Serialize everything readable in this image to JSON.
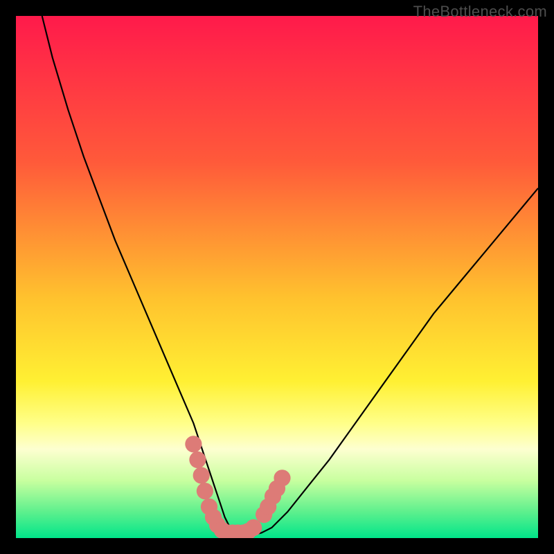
{
  "watermark": "TheBottleneck.com",
  "chart_data": {
    "type": "line",
    "title": "",
    "xlabel": "",
    "ylabel": "",
    "xlim": [
      0,
      100
    ],
    "ylim": [
      0,
      100
    ],
    "background_gradient": {
      "stops": [
        {
          "offset": 0,
          "color": "#ff1a4b"
        },
        {
          "offset": 28,
          "color": "#ff5a3a"
        },
        {
          "offset": 54,
          "color": "#ffc22e"
        },
        {
          "offset": 70,
          "color": "#fff033"
        },
        {
          "offset": 78,
          "color": "#ffff88"
        },
        {
          "offset": 83,
          "color": "#fdffd0"
        },
        {
          "offset": 89,
          "color": "#c8ff9f"
        },
        {
          "offset": 95,
          "color": "#5df08d"
        },
        {
          "offset": 100,
          "color": "#00e58a"
        }
      ]
    },
    "series": [
      {
        "name": "curve",
        "color": "#000000",
        "x": [
          5,
          7,
          10,
          13,
          16,
          19,
          22,
          25,
          28,
          31,
          34,
          35,
          36,
          37,
          38,
          39,
          40,
          41,
          42,
          43,
          45,
          47,
          49,
          52,
          56,
          60,
          65,
          70,
          75,
          80,
          85,
          90,
          95,
          100
        ],
        "values": [
          100,
          92,
          82,
          73,
          65,
          57,
          50,
          43,
          36,
          29,
          22,
          19,
          16,
          13,
          10,
          7,
          4,
          2,
          1,
          0.5,
          0.5,
          1,
          2,
          5,
          10,
          15,
          22,
          29,
          36,
          43,
          49,
          55,
          61,
          67
        ]
      }
    ],
    "markers": {
      "name": "dots",
      "color": "#dd7b77",
      "radius": 1.6,
      "points": [
        {
          "x": 34.0,
          "y": 18.0
        },
        {
          "x": 34.8,
          "y": 15.0
        },
        {
          "x": 35.5,
          "y": 12.0
        },
        {
          "x": 36.2,
          "y": 9.0
        },
        {
          "x": 37.0,
          "y": 6.0
        },
        {
          "x": 37.8,
          "y": 4.0
        },
        {
          "x": 38.6,
          "y": 2.5
        },
        {
          "x": 39.5,
          "y": 1.5
        },
        {
          "x": 40.5,
          "y": 1.0
        },
        {
          "x": 41.5,
          "y": 1.0
        },
        {
          "x": 42.5,
          "y": 1.0
        },
        {
          "x": 43.5,
          "y": 1.0
        },
        {
          "x": 44.5,
          "y": 1.3
        },
        {
          "x": 45.5,
          "y": 2.0
        },
        {
          "x": 47.5,
          "y": 4.5
        },
        {
          "x": 48.3,
          "y": 6.0
        },
        {
          "x": 49.2,
          "y": 8.0
        },
        {
          "x": 50.0,
          "y": 9.5
        },
        {
          "x": 51.0,
          "y": 11.5
        }
      ]
    }
  }
}
